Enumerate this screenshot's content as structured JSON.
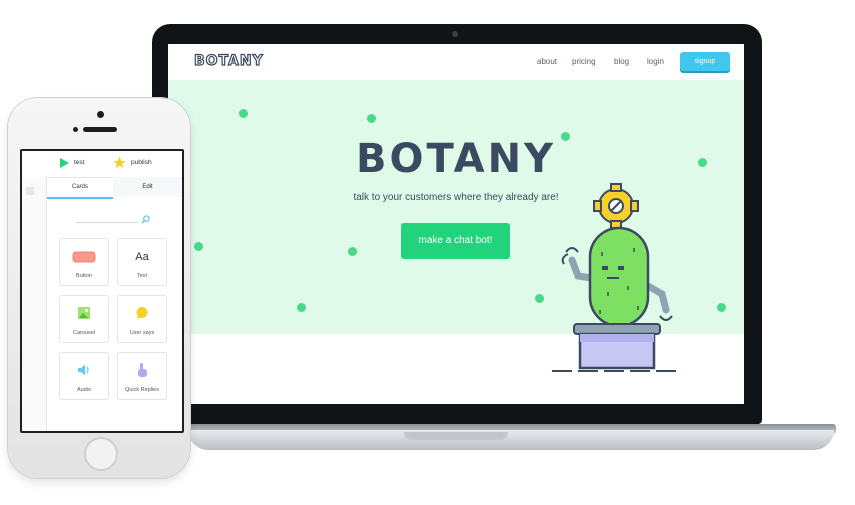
{
  "site": {
    "logo": "BOTANY",
    "nav": [
      "about",
      "pricing",
      "blog",
      "login"
    ],
    "signup_label": "signup",
    "hero": {
      "title": "BOTANY",
      "subtitle": "talk to your customers where they already are!",
      "cta_label": "make a chat bot!"
    },
    "colors": {
      "hero_bg": "#dffae8",
      "accent_green": "#21d37b",
      "accent_blue": "#3fc7ee",
      "ink": "#3a4a60"
    }
  },
  "app": {
    "toolbar": {
      "test_label": "test",
      "publish_label": "publish"
    },
    "tabs": [
      "Cards",
      "Edit"
    ],
    "active_tab": "Cards",
    "cards": [
      {
        "label": "Button",
        "icon": "button-icon"
      },
      {
        "label": "Text",
        "icon": "text-icon",
        "glyph": "Aa"
      },
      {
        "label": "Carousel",
        "icon": "image-icon"
      },
      {
        "label": "User says",
        "icon": "speech-bubble-icon"
      },
      {
        "label": "Audio",
        "icon": "speaker-icon"
      },
      {
        "label": "Quick Replies",
        "icon": "hand-pointer-icon"
      }
    ]
  }
}
